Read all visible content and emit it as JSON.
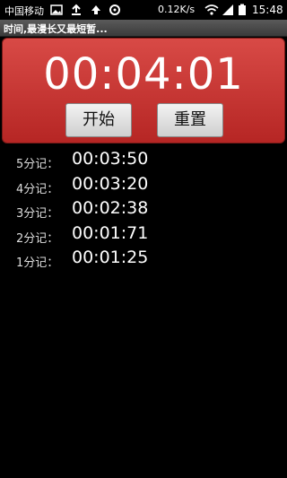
{
  "statusbar": {
    "carrier": "中国移动",
    "speed": "0.12K/s",
    "time": "15:48",
    "icons": [
      "image-icon",
      "upload-icon",
      "sync-icon",
      "wifi-icon",
      "signal-icon",
      "battery-icon"
    ]
  },
  "app": {
    "title": "时间,最漫长又最短暂..."
  },
  "timer": {
    "display": "00:04:01"
  },
  "buttons": {
    "start": "开始",
    "reset": "重置"
  },
  "laps": [
    {
      "label": "5分记：",
      "time": "00:03:50"
    },
    {
      "label": "4分记：",
      "time": "00:03:20"
    },
    {
      "label": "3分记：",
      "time": "00:02:38"
    },
    {
      "label": "2分记：",
      "time": "00:01:71"
    },
    {
      "label": "1分记：",
      "time": "00:01:25"
    }
  ],
  "colors": {
    "panel": "#c9302c",
    "background": "#000000",
    "text": "#ffffff"
  }
}
